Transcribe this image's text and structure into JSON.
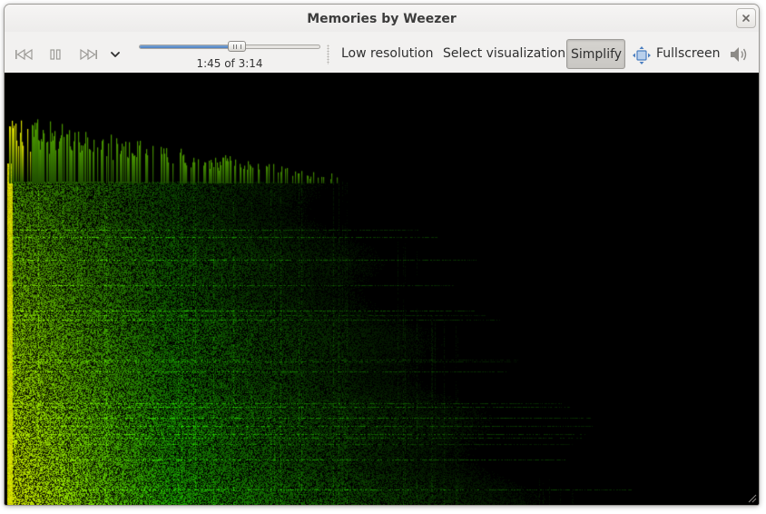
{
  "window": {
    "title": "Memories by Weezer"
  },
  "controls": {
    "previous_icon": "skip-previous-icon",
    "pause_icon": "pause-icon",
    "next_icon": "skip-next-icon",
    "menu_icon": "chevron-down-icon"
  },
  "seek": {
    "time_text": "1:45 of 3:14",
    "progress_fraction": 0.541
  },
  "toolbar": {
    "low_resolution_label": "Low resolution",
    "select_visualization_label": "Select visualization",
    "simplify_label": "Simplify",
    "fullscreen_label": "Fullscreen",
    "fullscreen_icon": "fullscreen-arrows-icon",
    "volume_icon": "volume-icon"
  },
  "colors": {
    "viz_background": "#000000",
    "spectrum_bright": "#e6e600",
    "spectrum_mid": "#4c9a00",
    "spectrum_dim": "#1f4d00",
    "accent": "#4c7fc0"
  }
}
